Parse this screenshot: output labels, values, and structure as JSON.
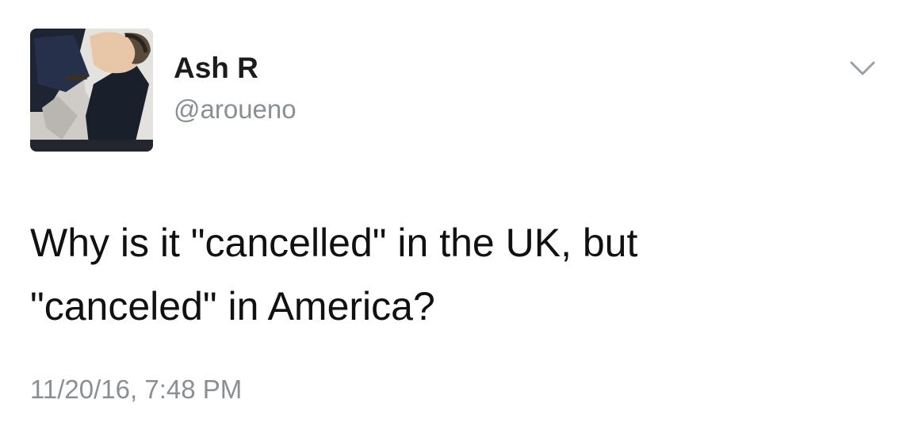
{
  "tweet": {
    "author": {
      "display_name": "Ash R",
      "handle": "@aroueno",
      "avatar_icon": "profile-photo"
    },
    "menu_icon": "chevron-down-icon",
    "text_lines": [
      "Why is it \"cancelled\" in the UK, but",
      "\"canceled\" in America?"
    ],
    "timestamp": "11/20/16, 7:48 PM"
  },
  "colors": {
    "name": "#1c1c1c",
    "secondary": "#8a8f94",
    "text": "#111111",
    "background": "#ffffff"
  }
}
